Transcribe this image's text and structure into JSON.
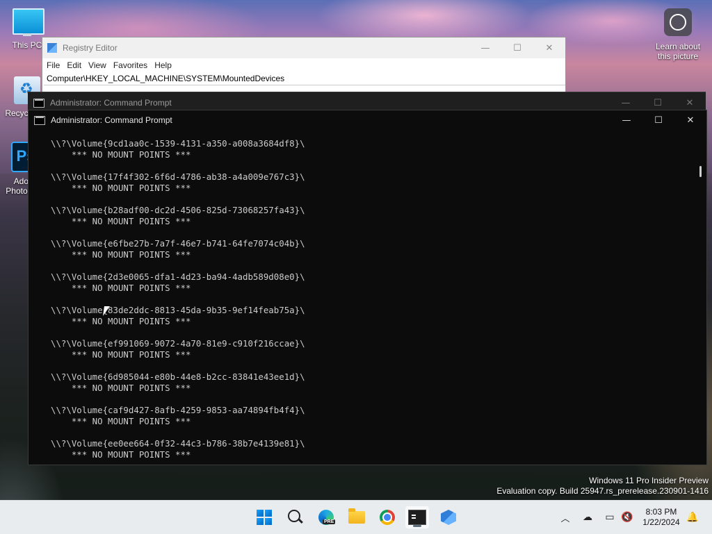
{
  "desktop": {
    "icons": [
      {
        "label": "This PC"
      },
      {
        "label": "Recycle Bin"
      },
      {
        "label": "Adobe Photoshop"
      }
    ],
    "learn_label": "Learn about this picture"
  },
  "regedit": {
    "title": "Registry Editor",
    "menu": [
      "File",
      "Edit",
      "View",
      "Favorites",
      "Help"
    ],
    "address": "Computer\\HKEY_LOCAL_MACHINE\\SYSTEM\\MountedDevices"
  },
  "cmd_back": {
    "title": "Administrator: Command Prompt"
  },
  "cmd_front": {
    "title": "Administrator: Command Prompt",
    "no_mount": "*** NO MOUNT POINTS ***",
    "volumes": [
      "\\\\?\\Volume{9cd1aa0c-1539-4131-a350-a008a3684df8}\\",
      "\\\\?\\Volume{17f4f302-6f6d-4786-ab38-a4a009e767c3}\\",
      "\\\\?\\Volume{b28adf00-dc2d-4506-825d-73068257fa43}\\",
      "\\\\?\\Volume{e6fbe27b-7a7f-46e7-b741-64fe7074c04b}\\",
      "\\\\?\\Volume{2d3e0065-dfa1-4d23-ba94-4adb589d08e0}\\",
      "\\\\?\\Volume{83de2ddc-8813-45da-9b35-9ef14feab75a}\\",
      "\\\\?\\Volume{ef991069-9072-4a70-81e9-c910f216ccae}\\",
      "\\\\?\\Volume{6d985044-e80b-44e8-b2cc-83841e43ee1d}\\",
      "\\\\?\\Volume{caf9d427-8afb-4259-9853-aa74894fb4f4}\\",
      "\\\\?\\Volume{ee0ee664-0f32-44c3-b786-38b7e4139e81}\\"
    ]
  },
  "watermark": {
    "line1": "Windows 11 Pro Insider Preview",
    "line2": "Evaluation copy. Build 25947.rs_prerelease.230901-1416"
  },
  "taskbar": {
    "time": "8:03 PM",
    "date": "1/22/2024",
    "apps": [
      "start-icon",
      "search-icon",
      "edge-icon",
      "file-explorer-icon",
      "chrome-icon",
      "terminal-icon",
      "regedit-icon"
    ]
  }
}
